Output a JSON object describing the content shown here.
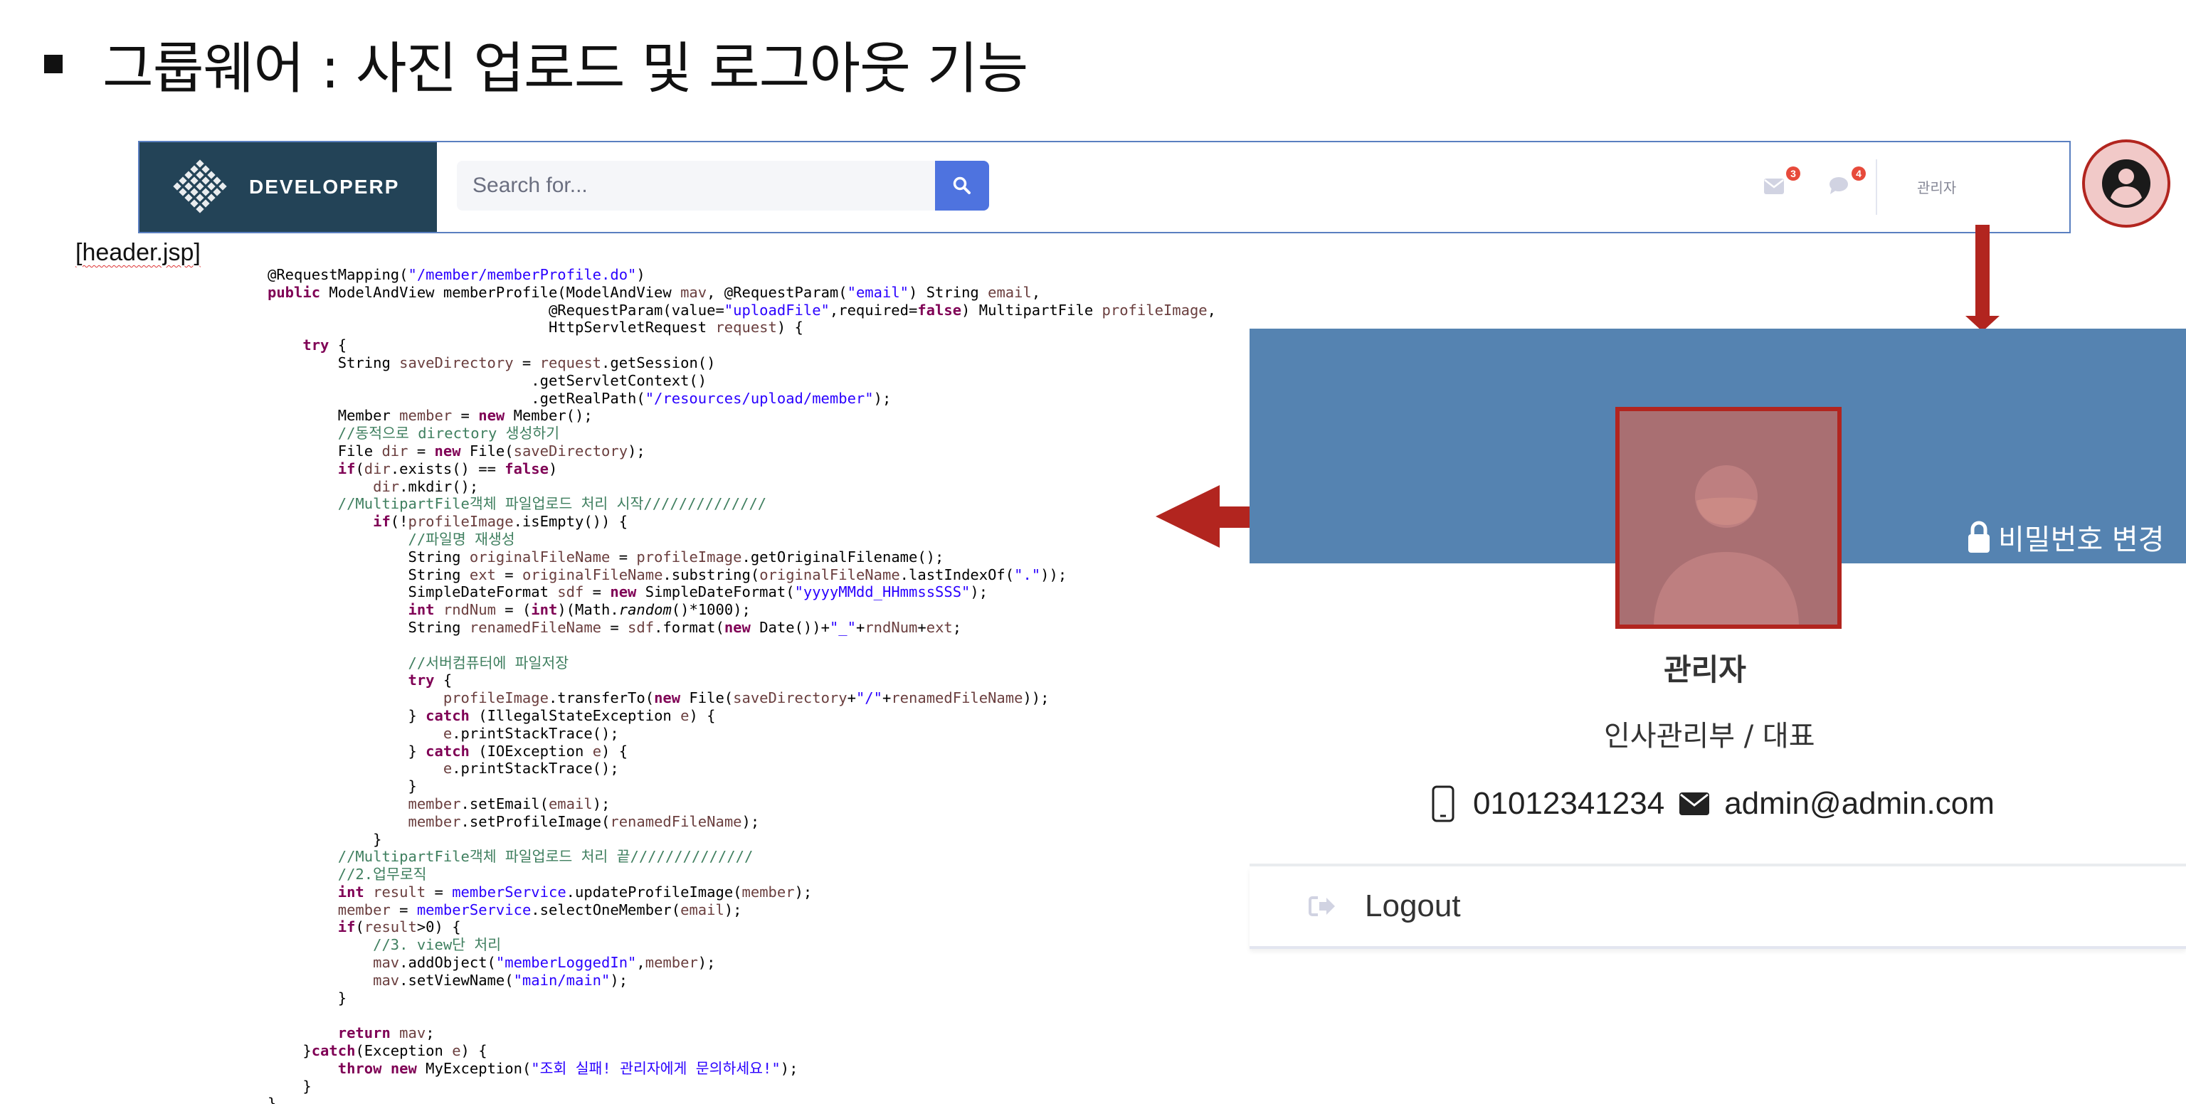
{
  "slide": {
    "title": "그룹웨어 : 사진 업로드 및 로그아웃 기능",
    "file_label": "[header.jsp]"
  },
  "navbar": {
    "brand": "DEVELOPERP",
    "search_placeholder": "Search for...",
    "alerts_count": "3",
    "messages_count": "4",
    "user_name": "관리자"
  },
  "code_lines": [
    [
      {
        "t": "@RequestMapping(",
        "c": ""
      },
      {
        "t": "\"/member/memberProfile.do\"",
        "c": "str"
      },
      {
        "t": ")",
        "c": ""
      }
    ],
    [
      {
        "t": "public",
        "c": "kw"
      },
      {
        "t": " ModelAndView memberProfile(ModelAndView ",
        "c": ""
      },
      {
        "t": "mav",
        "c": "fld"
      },
      {
        "t": ", @RequestParam(",
        "c": ""
      },
      {
        "t": "\"email\"",
        "c": "str"
      },
      {
        "t": ") String ",
        "c": ""
      },
      {
        "t": "email",
        "c": "fld"
      },
      {
        "t": ",",
        "c": ""
      }
    ],
    [
      {
        "t": "                                @RequestParam(value=",
        "c": ""
      },
      {
        "t": "\"uploadFile\"",
        "c": "str"
      },
      {
        "t": ",required=",
        "c": ""
      },
      {
        "t": "false",
        "c": "kw"
      },
      {
        "t": ") MultipartFile ",
        "c": ""
      },
      {
        "t": "profileImage",
        "c": "fld"
      },
      {
        "t": ",",
        "c": ""
      }
    ],
    [
      {
        "t": "                                HttpServletRequest ",
        "c": ""
      },
      {
        "t": "request",
        "c": "fld"
      },
      {
        "t": ") {",
        "c": ""
      }
    ],
    [
      {
        "t": "    ",
        "c": ""
      },
      {
        "t": "try",
        "c": "kw"
      },
      {
        "t": " {",
        "c": ""
      }
    ],
    [
      {
        "t": "        String ",
        "c": ""
      },
      {
        "t": "saveDirectory",
        "c": "fld"
      },
      {
        "t": " = ",
        "c": ""
      },
      {
        "t": "request",
        "c": "fld"
      },
      {
        "t": ".getSession()",
        "c": ""
      }
    ],
    [
      {
        "t": "                              .getServletContext()",
        "c": ""
      }
    ],
    [
      {
        "t": "                              .getRealPath(",
        "c": ""
      },
      {
        "t": "\"/resources/upload/member\"",
        "c": "str"
      },
      {
        "t": ");",
        "c": ""
      }
    ],
    [
      {
        "t": "        Member ",
        "c": ""
      },
      {
        "t": "member",
        "c": "fld"
      },
      {
        "t": " = ",
        "c": ""
      },
      {
        "t": "new",
        "c": "kw"
      },
      {
        "t": " Member();",
        "c": ""
      }
    ],
    [
      {
        "t": "        //동적으로 directory 생성하기",
        "c": "cm"
      }
    ],
    [
      {
        "t": "        File ",
        "c": ""
      },
      {
        "t": "dir",
        "c": "fld"
      },
      {
        "t": " = ",
        "c": ""
      },
      {
        "t": "new",
        "c": "kw"
      },
      {
        "t": " File(",
        "c": ""
      },
      {
        "t": "saveDirectory",
        "c": "fld"
      },
      {
        "t": ");",
        "c": ""
      }
    ],
    [
      {
        "t": "        ",
        "c": ""
      },
      {
        "t": "if",
        "c": "kw"
      },
      {
        "t": "(",
        "c": ""
      },
      {
        "t": "dir",
        "c": "fld"
      },
      {
        "t": ".exists() == ",
        "c": ""
      },
      {
        "t": "false",
        "c": "kw"
      },
      {
        "t": ")",
        "c": ""
      }
    ],
    [
      {
        "t": "            ",
        "c": ""
      },
      {
        "t": "dir",
        "c": "fld"
      },
      {
        "t": ".mkdir();",
        "c": ""
      }
    ],
    [
      {
        "t": "        //MultipartFile객체 파일업로드 처리 시작//////////////",
        "c": "cm"
      }
    ],
    [
      {
        "t": "            ",
        "c": ""
      },
      {
        "t": "if",
        "c": "kw"
      },
      {
        "t": "(!",
        "c": ""
      },
      {
        "t": "profileImage",
        "c": "fld"
      },
      {
        "t": ".isEmpty()) {",
        "c": ""
      }
    ],
    [
      {
        "t": "                //파일명 재생성",
        "c": "cm"
      }
    ],
    [
      {
        "t": "                String ",
        "c": ""
      },
      {
        "t": "originalFileName",
        "c": "fld"
      },
      {
        "t": " = ",
        "c": ""
      },
      {
        "t": "profileImage",
        "c": "fld"
      },
      {
        "t": ".getOriginalFilename();",
        "c": ""
      }
    ],
    [
      {
        "t": "                String ",
        "c": ""
      },
      {
        "t": "ext",
        "c": "fld"
      },
      {
        "t": " = ",
        "c": ""
      },
      {
        "t": "originalFileName",
        "c": "fld"
      },
      {
        "t": ".substring(",
        "c": ""
      },
      {
        "t": "originalFileName",
        "c": "fld"
      },
      {
        "t": ".lastIndexOf(",
        "c": ""
      },
      {
        "t": "\".\"",
        "c": "str"
      },
      {
        "t": "));",
        "c": ""
      }
    ],
    [
      {
        "t": "                SimpleDateFormat ",
        "c": ""
      },
      {
        "t": "sdf",
        "c": "fld"
      },
      {
        "t": " = ",
        "c": ""
      },
      {
        "t": "new",
        "c": "kw"
      },
      {
        "t": " SimpleDateFormat(",
        "c": ""
      },
      {
        "t": "\"yyyyMMdd_HHmmssSSS\"",
        "c": "str"
      },
      {
        "t": ");",
        "c": ""
      }
    ],
    [
      {
        "t": "                ",
        "c": ""
      },
      {
        "t": "int",
        "c": "kw"
      },
      {
        "t": " ",
        "c": ""
      },
      {
        "t": "rndNum",
        "c": "fld"
      },
      {
        "t": " = (",
        "c": ""
      },
      {
        "t": "int",
        "c": "kw"
      },
      {
        "t": ")(Math.",
        "c": ""
      },
      {
        "t": "random",
        "c": "it"
      },
      {
        "t": "()*1000);",
        "c": ""
      }
    ],
    [
      {
        "t": "                String ",
        "c": ""
      },
      {
        "t": "renamedFileName",
        "c": "fld"
      },
      {
        "t": " = ",
        "c": ""
      },
      {
        "t": "sdf",
        "c": "fld"
      },
      {
        "t": ".format(",
        "c": ""
      },
      {
        "t": "new",
        "c": "kw"
      },
      {
        "t": " Date())+",
        "c": ""
      },
      {
        "t": "\"_\"",
        "c": "str"
      },
      {
        "t": "+",
        "c": ""
      },
      {
        "t": "rndNum",
        "c": "fld"
      },
      {
        "t": "+",
        "c": ""
      },
      {
        "t": "ext",
        "c": "fld"
      },
      {
        "t": ";",
        "c": ""
      }
    ],
    [
      {
        "t": "",
        "c": ""
      }
    ],
    [
      {
        "t": "                //서버컴퓨터에 파일저장",
        "c": "cm"
      }
    ],
    [
      {
        "t": "                ",
        "c": ""
      },
      {
        "t": "try",
        "c": "kw"
      },
      {
        "t": " {",
        "c": ""
      }
    ],
    [
      {
        "t": "                    ",
        "c": ""
      },
      {
        "t": "profileImage",
        "c": "fld"
      },
      {
        "t": ".transferTo(",
        "c": ""
      },
      {
        "t": "new",
        "c": "kw"
      },
      {
        "t": " File(",
        "c": ""
      },
      {
        "t": "saveDirectory",
        "c": "fld"
      },
      {
        "t": "+",
        "c": ""
      },
      {
        "t": "\"/\"",
        "c": "str"
      },
      {
        "t": "+",
        "c": ""
      },
      {
        "t": "renamedFileName",
        "c": "fld"
      },
      {
        "t": "));",
        "c": ""
      }
    ],
    [
      {
        "t": "                } ",
        "c": ""
      },
      {
        "t": "catch",
        "c": "kw"
      },
      {
        "t": " (IllegalStateException ",
        "c": ""
      },
      {
        "t": "e",
        "c": "fld"
      },
      {
        "t": ") {",
        "c": ""
      }
    ],
    [
      {
        "t": "                    ",
        "c": ""
      },
      {
        "t": "e",
        "c": "fld"
      },
      {
        "t": ".printStackTrace();",
        "c": ""
      }
    ],
    [
      {
        "t": "                } ",
        "c": ""
      },
      {
        "t": "catch",
        "c": "kw"
      },
      {
        "t": " (IOException ",
        "c": ""
      },
      {
        "t": "e",
        "c": "fld"
      },
      {
        "t": ") {",
        "c": ""
      }
    ],
    [
      {
        "t": "                    ",
        "c": ""
      },
      {
        "t": "e",
        "c": "fld"
      },
      {
        "t": ".printStackTrace();",
        "c": ""
      }
    ],
    [
      {
        "t": "                }",
        "c": ""
      }
    ],
    [
      {
        "t": "                ",
        "c": ""
      },
      {
        "t": "member",
        "c": "fld"
      },
      {
        "t": ".setEmail(",
        "c": ""
      },
      {
        "t": "email",
        "c": "fld"
      },
      {
        "t": ");",
        "c": ""
      }
    ],
    [
      {
        "t": "                ",
        "c": ""
      },
      {
        "t": "member",
        "c": "fld"
      },
      {
        "t": ".setProfileImage(",
        "c": ""
      },
      {
        "t": "renamedFileName",
        "c": "fld"
      },
      {
        "t": ");",
        "c": ""
      }
    ],
    [
      {
        "t": "            }",
        "c": ""
      }
    ],
    [
      {
        "t": "        //MultipartFile객체 파일업로드 처리 끝//////////////",
        "c": "cm"
      }
    ],
    [
      {
        "t": "        //2.업무로직",
        "c": "cm"
      }
    ],
    [
      {
        "t": "        ",
        "c": ""
      },
      {
        "t": "int",
        "c": "kw"
      },
      {
        "t": " ",
        "c": ""
      },
      {
        "t": "result",
        "c": "fld"
      },
      {
        "t": " = ",
        "c": ""
      },
      {
        "t": "memberService",
        "c": "str"
      },
      {
        "t": ".updateProfileImage(",
        "c": ""
      },
      {
        "t": "member",
        "c": "fld"
      },
      {
        "t": ");",
        "c": ""
      }
    ],
    [
      {
        "t": "        ",
        "c": ""
      },
      {
        "t": "member",
        "c": "fld"
      },
      {
        "t": " = ",
        "c": ""
      },
      {
        "t": "memberService",
        "c": "str"
      },
      {
        "t": ".selectOneMember(",
        "c": ""
      },
      {
        "t": "email",
        "c": "fld"
      },
      {
        "t": ");",
        "c": ""
      }
    ],
    [
      {
        "t": "        ",
        "c": ""
      },
      {
        "t": "if",
        "c": "kw"
      },
      {
        "t": "(",
        "c": ""
      },
      {
        "t": "result",
        "c": "fld"
      },
      {
        "t": ">0) {",
        "c": ""
      }
    ],
    [
      {
        "t": "            //3. view단 처리",
        "c": "cm"
      }
    ],
    [
      {
        "t": "            ",
        "c": ""
      },
      {
        "t": "mav",
        "c": "fld"
      },
      {
        "t": ".addObject(",
        "c": ""
      },
      {
        "t": "\"memberLoggedIn\"",
        "c": "str"
      },
      {
        "t": ",",
        "c": ""
      },
      {
        "t": "member",
        "c": "fld"
      },
      {
        "t": ");",
        "c": ""
      }
    ],
    [
      {
        "t": "            ",
        "c": ""
      },
      {
        "t": "mav",
        "c": "fld"
      },
      {
        "t": ".setViewName(",
        "c": ""
      },
      {
        "t": "\"main/main\"",
        "c": "str"
      },
      {
        "t": ");",
        "c": ""
      }
    ],
    [
      {
        "t": "        }",
        "c": ""
      }
    ],
    [
      {
        "t": "",
        "c": ""
      }
    ],
    [
      {
        "t": "        ",
        "c": ""
      },
      {
        "t": "return",
        "c": "kw"
      },
      {
        "t": " ",
        "c": ""
      },
      {
        "t": "mav",
        "c": "fld"
      },
      {
        "t": ";",
        "c": ""
      }
    ],
    [
      {
        "t": "    }",
        "c": ""
      },
      {
        "t": "catch",
        "c": "kw"
      },
      {
        "t": "(Exception ",
        "c": ""
      },
      {
        "t": "e",
        "c": "fld"
      },
      {
        "t": ") {",
        "c": ""
      }
    ],
    [
      {
        "t": "        ",
        "c": ""
      },
      {
        "t": "throw",
        "c": "kw"
      },
      {
        "t": " ",
        "c": ""
      },
      {
        "t": "new",
        "c": "kw"
      },
      {
        "t": " MyException(",
        "c": ""
      },
      {
        "t": "\"조회 실패! 관리자에게 문의하세요!\"",
        "c": "str"
      },
      {
        "t": ");",
        "c": ""
      }
    ],
    [
      {
        "t": "    }",
        "c": ""
      }
    ],
    [
      {
        "t": "}",
        "c": ""
      }
    ]
  ],
  "profile": {
    "password_change": "비밀번호 변경",
    "name": "관리자",
    "department": "인사관리부 / 대표",
    "phone": "01012341234",
    "email": "admin@admin.com",
    "logout_label": "Logout"
  },
  "colors": {
    "brand_bg": "#234357",
    "accent": "#4e73df",
    "banner": "#5583b1",
    "highlight": "#b2251f",
    "badge": "#e74a3b"
  },
  "icons": [
    "search-icon",
    "envelope-icon",
    "comment-icon",
    "user-circle-icon",
    "lock-icon",
    "mobile-phone-icon",
    "sign-out-icon"
  ]
}
